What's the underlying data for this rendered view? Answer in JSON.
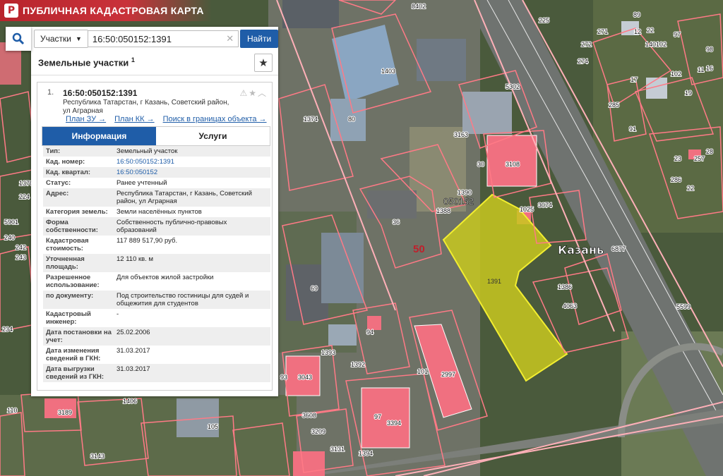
{
  "app": {
    "title": "ПУБЛИЧНАЯ КАДАСТРОВАЯ КАРТА",
    "logo_letter": "Р"
  },
  "search": {
    "type_label": "Участки",
    "query": "16:50:050152:1391",
    "find_label": "Найти"
  },
  "panel": {
    "section_title": "Земельные участки",
    "section_count": "1"
  },
  "card": {
    "index": "1.",
    "cad_number": "16:50:050152:1391",
    "address": "Республика Татарстан, г Казань, Советский район, ул Аграрная",
    "links": [
      "План ЗУ →",
      "План КК →",
      "Поиск в границах объекта →"
    ],
    "tabs": [
      "Информация",
      "Услуги"
    ],
    "rows": [
      {
        "k": "Тип:",
        "v": "Земельный участок"
      },
      {
        "k": "Кад. номер:",
        "v": "16:50:050152:1391"
      },
      {
        "k": "Кад. квартал:",
        "v": "16:50:050152"
      },
      {
        "k": "Статус:",
        "v": "Ранее учтенный"
      },
      {
        "k": "Адрес:",
        "v": "Республика Татарстан, г Казань, Советский район, ул Аграрная"
      },
      {
        "k": "Категория земель:",
        "v": "Земли населённых пунктов"
      },
      {
        "k": "Форма собственности:",
        "v": "Собственность публично-правовых образований"
      },
      {
        "k": "Кадастровая стоимость:",
        "v": "117 889 517,90 руб."
      },
      {
        "k": "Уточненная площадь:",
        "v": "12 110 кв. м"
      },
      {
        "k": "Разрешенное использование:",
        "v": "Для объектов жилой застройки"
      },
      {
        "k": "по документу:",
        "v": "Под строительство гостиницы для судей и общежития для студентов"
      },
      {
        "k": "Кадастровый инженер:",
        "v": "-"
      },
      {
        "k": "Дата постановки на учет:",
        "v": "25.02.2006"
      },
      {
        "k": "Дата изменения сведений в ГКН:",
        "v": "31.03.2017"
      },
      {
        "k": "Дата выгрузки сведений из ГКН:",
        "v": "31.03.2017"
      }
    ]
  },
  "map": {
    "city_label": "Казань",
    "block_label": "050152",
    "district_label": "50",
    "selected_parcel": "1391",
    "labels": [
      "1402",
      "1403",
      "1374",
      "80",
      "3163",
      "3108",
      "30",
      "1388",
      "1390",
      "36",
      "3074",
      "1025",
      "6877",
      "5599",
      "1386",
      "4063",
      "69",
      "94",
      "1393",
      "1392",
      "101",
      "2997",
      "93",
      "3043",
      "97",
      "3394",
      "3608",
      "3209",
      "3131",
      "1394",
      "1406",
      "105",
      "3189",
      "3143",
      "110",
      "234",
      "242",
      "243",
      "240",
      "5901",
      "1370",
      "224",
      "225",
      "272",
      "274",
      "271",
      "5302",
      "89",
      "12",
      "22",
      "97",
      "140102",
      "98",
      "16",
      "102",
      "17",
      "19",
      "285",
      "91",
      "23",
      "257",
      "286",
      "22",
      "28",
      "11",
      "8"
    ],
    "accent": "#1f5da8",
    "parcel_color": "#c8c81e",
    "boundary_color": "#ff7a86"
  }
}
